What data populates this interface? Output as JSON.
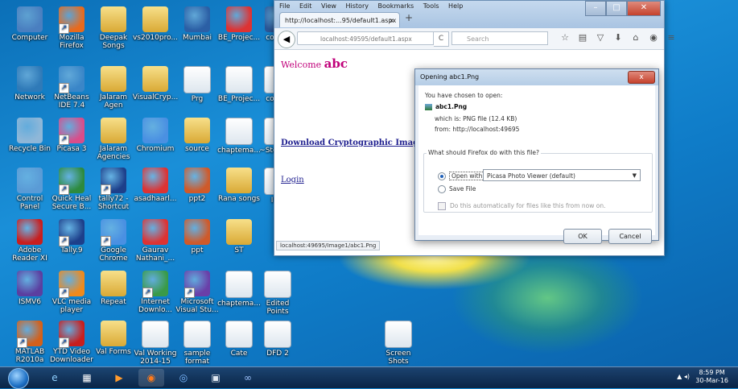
{
  "desktop_icons": [
    {
      "label": "Computer",
      "kind": "computer-icon",
      "color": "#4a7fc0"
    },
    {
      "label": "Mozilla Firefox",
      "kind": "firefox-icon",
      "color": "#e86a1c"
    },
    {
      "label": "Deepak Songs",
      "kind": "folder-icon",
      "color": "#e0b84a"
    },
    {
      "label": "vs2010pro...",
      "kind": "folder-icon",
      "color": "#3d6fb0"
    },
    {
      "label": "Mumbai",
      "kind": "mumbai-icon",
      "color": "#2b5fa5"
    },
    {
      "label": "BE_Projec...",
      "kind": "pdf-icon",
      "color": "#d33"
    },
    {
      "label": "cover_",
      "kind": "word-icon",
      "color": "#2b5797"
    },
    {
      "label": "Network",
      "kind": "network-icon",
      "color": "#2f7ab8"
    },
    {
      "label": "NetBeans IDE 7.4",
      "kind": "netbeans-icon",
      "color": "#3a86c8"
    },
    {
      "label": "Jalaram Agen",
      "kind": "folder-icon",
      "color": "#e0b84a"
    },
    {
      "label": "VisualCryp...",
      "kind": "folder-icon",
      "color": "#3d6fb0"
    },
    {
      "label": "Prg",
      "kind": "doc-icon",
      "color": "#bcd"
    },
    {
      "label": "BE_Projec...",
      "kind": "doc-icon",
      "color": "#bcd"
    },
    {
      "label": "cover_",
      "kind": "doc-icon",
      "color": "#bcd"
    },
    {
      "label": "Recycle Bin",
      "kind": "recycle-bin-icon",
      "color": "#8fb7d8"
    },
    {
      "label": "Picasa 3",
      "kind": "picasa-icon",
      "color": "#d94d8a"
    },
    {
      "label": "Jalaram Agencies",
      "kind": "folder-icon",
      "color": "#e0b84a"
    },
    {
      "label": "Chromium",
      "kind": "chromium-icon",
      "color": "#4a90e2"
    },
    {
      "label": "source",
      "kind": "folder-icon",
      "color": "#e0b84a"
    },
    {
      "label": "chaptema...",
      "kind": "doc-icon",
      "color": "#bcd"
    },
    {
      "label": "~Ste Shot",
      "kind": "doc-icon",
      "color": "#bcd"
    },
    {
      "label": "Control Panel",
      "kind": "control-panel-icon",
      "color": "#5a9bd6"
    },
    {
      "label": "Quick Heal Secure B...",
      "kind": "quickheal-icon",
      "color": "#2d8a3e"
    },
    {
      "label": "tally72 - Shortcut",
      "kind": "tally-icon",
      "color": "#1d3f8a"
    },
    {
      "label": "asadhaarl...",
      "kind": "pdf-icon",
      "color": "#d33"
    },
    {
      "label": "ppt2",
      "kind": "ppt-icon",
      "color": "#cf5a2a"
    },
    {
      "label": "Rana songs",
      "kind": "folder-icon",
      "color": "#e0b84a"
    },
    {
      "label": "ISTI",
      "kind": "doc-icon",
      "color": "#bcd"
    },
    {
      "label": "Adobe Reader XI",
      "kind": "adobe-reader-icon",
      "color": "#c81e1e"
    },
    {
      "label": "Tally.9",
      "kind": "tally-icon",
      "color": "#1d3f8a"
    },
    {
      "label": "Google Chrome",
      "kind": "chrome-icon",
      "color": "#4a90e2"
    },
    {
      "label": "Gaurav Nathani_...",
      "kind": "pdf-icon",
      "color": "#d33"
    },
    {
      "label": "ppt",
      "kind": "ppt-icon",
      "color": "#cf5a2a"
    },
    {
      "label": "ST",
      "kind": "folder-icon",
      "color": "#e0b84a"
    },
    {
      "label": "ISMV6",
      "kind": "ism-icon",
      "color": "#5b3fa0"
    },
    {
      "label": "VLC media player",
      "kind": "vlc-icon",
      "color": "#f08a1c"
    },
    {
      "label": "Repeat",
      "kind": "folder-icon",
      "color": "#e0b84a"
    },
    {
      "label": "Internet Downlo...",
      "kind": "idm-icon",
      "color": "#3a9a48"
    },
    {
      "label": "Microsoft Visual Stu...",
      "kind": "visual-studio-icon",
      "color": "#6a3fa8"
    },
    {
      "label": "chaptema...",
      "kind": "doc-icon",
      "color": "#bcd"
    },
    {
      "label": "Edited Points",
      "kind": "doc-icon",
      "color": "#bcd"
    },
    {
      "label": "MATLAB R2010a",
      "kind": "matlab-icon",
      "color": "#d3601a"
    },
    {
      "label": "YTD Video Downloader",
      "kind": "ytd-icon",
      "color": "#c81e1e"
    },
    {
      "label": "Val Forms",
      "kind": "folder-icon",
      "color": "#e0b84a"
    },
    {
      "label": "Val Working 2014-15",
      "kind": "doc-icon",
      "color": "#bcd"
    },
    {
      "label": "sample format",
      "kind": "doc-icon",
      "color": "#bcd"
    },
    {
      "label": "Cate",
      "kind": "doc-icon",
      "color": "#bcd"
    },
    {
      "label": "DFD 2",
      "kind": "doc-icon",
      "color": "#bcd"
    },
    {
      "label": "Screen Shots",
      "kind": "doc-icon",
      "color": "#bcd"
    }
  ],
  "browser": {
    "menu": [
      "File",
      "Edit",
      "View",
      "History",
      "Bookmarks",
      "Tools",
      "Help"
    ],
    "tab_title": "http://localhost:...95/default1.aspx",
    "tab_close": "×",
    "new_tab": "+",
    "url": "localhost:49595/default1.aspx",
    "search_placeholder": "Search",
    "welcome_prefix": "Welcome",
    "welcome_user": "abc",
    "download_link": "Download Cryptographic Image !!",
    "login_link": "Login",
    "status_url": "localhost:49695/Image1/abc1.Png"
  },
  "dialog": {
    "title": "Opening abc1.Png",
    "close": "x",
    "intro": "You have chosen to open:",
    "filename": "abc1.Png",
    "which_is": "which is:  PNG file (12.4 KB)",
    "from": "from:  http://localhost:49695",
    "question": "What should Firefox do with this file?",
    "open_with_label": "Open with",
    "open_with_app": "Picasa Photo Viewer (default)",
    "save_file_label": "Save File",
    "auto_label": "Do this automatically for files like this from now on.",
    "ok": "OK",
    "cancel": "Cancel"
  },
  "taskbar": {
    "time": "8:59 PM",
    "date": "30-Mar-16"
  }
}
